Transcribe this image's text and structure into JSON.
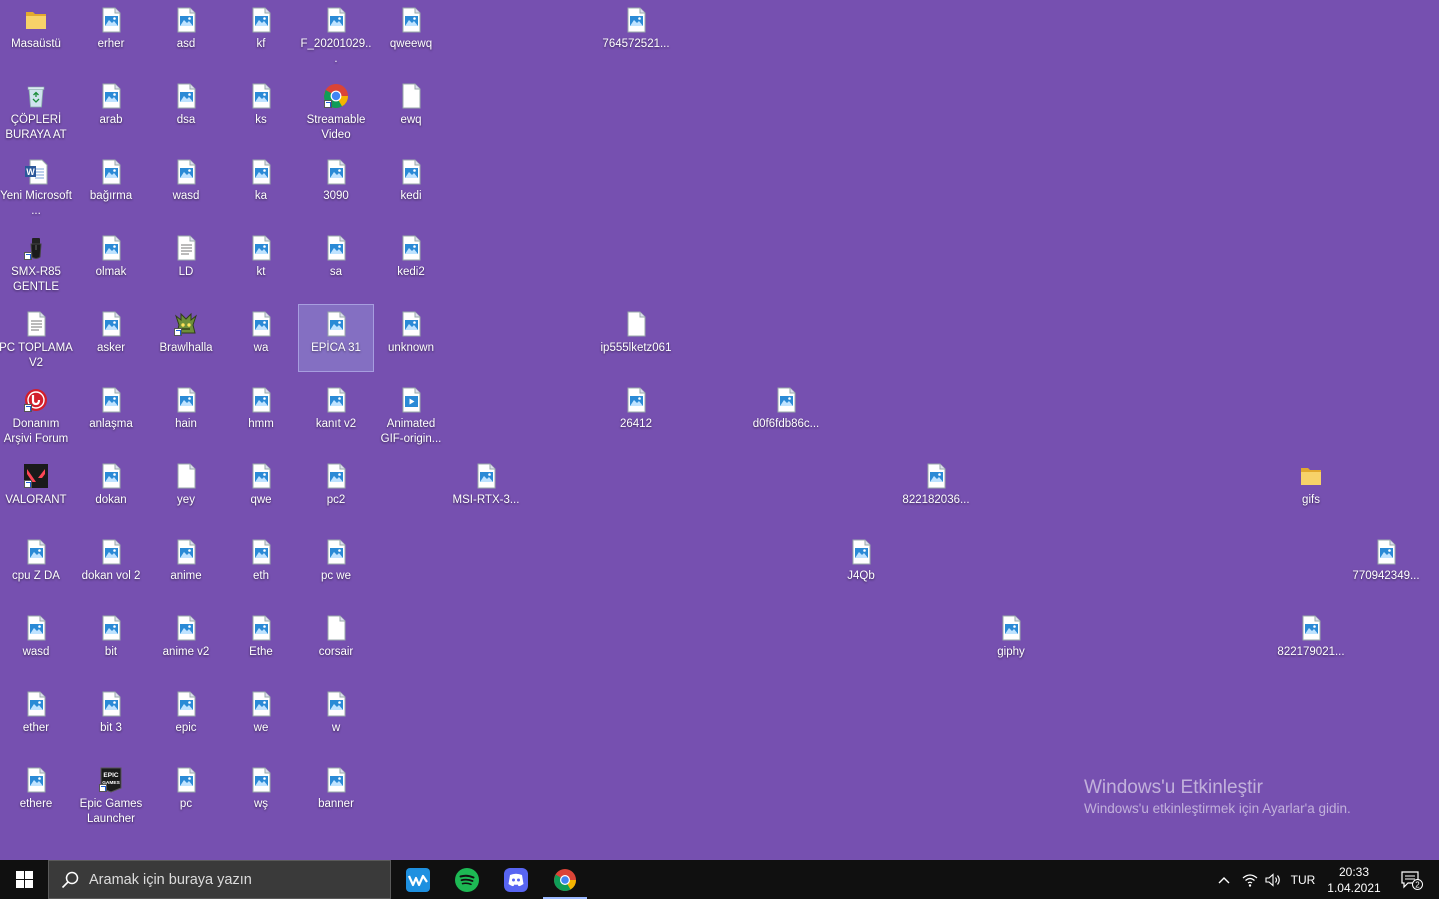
{
  "desktop": {
    "background_color": "#7650b0",
    "icons": [
      {
        "label": "Masaüstü",
        "type": "folder",
        "col": 0,
        "row": 0
      },
      {
        "label": "ÇÖPLERİ BURAYA AT",
        "type": "recycle",
        "col": 0,
        "row": 1
      },
      {
        "label": "Yeni Microsoft ...",
        "type": "word",
        "col": 0,
        "row": 2
      },
      {
        "label": "SMX-R85 GENTLE",
        "type": "mouse",
        "col": 0,
        "row": 3
      },
      {
        "label": "PC TOPLAMA V2",
        "type": "text",
        "col": 0,
        "row": 4
      },
      {
        "label": "Donanım Arşivi Forum",
        "type": "donanim",
        "col": 0,
        "row": 5
      },
      {
        "label": "VALORANT",
        "type": "valorant",
        "col": 0,
        "row": 6
      },
      {
        "label": "cpu Z DA",
        "type": "image",
        "col": 0,
        "row": 7
      },
      {
        "label": "wasd",
        "type": "image",
        "col": 0,
        "row": 8
      },
      {
        "label": "ether",
        "type": "image",
        "col": 0,
        "row": 9
      },
      {
        "label": "ethere",
        "type": "image",
        "col": 0,
        "row": 10
      },
      {
        "label": "erher",
        "type": "image",
        "col": 1,
        "row": 0
      },
      {
        "label": "arab",
        "type": "image",
        "col": 1,
        "row": 1
      },
      {
        "label": "bağırma",
        "type": "image",
        "col": 1,
        "row": 2
      },
      {
        "label": "olmak",
        "type": "image",
        "col": 1,
        "row": 3
      },
      {
        "label": "asker",
        "type": "image",
        "col": 1,
        "row": 4
      },
      {
        "label": "anlaşma",
        "type": "image",
        "col": 1,
        "row": 5
      },
      {
        "label": "dokan",
        "type": "image",
        "col": 1,
        "row": 6
      },
      {
        "label": "dokan vol 2",
        "type": "image",
        "col": 1,
        "row": 7
      },
      {
        "label": "bit",
        "type": "image",
        "col": 1,
        "row": 8
      },
      {
        "label": "bit 3",
        "type": "image",
        "col": 1,
        "row": 9
      },
      {
        "label": "Epic Games Launcher",
        "type": "epic",
        "col": 1,
        "row": 10
      },
      {
        "label": "asd",
        "type": "image",
        "col": 2,
        "row": 0
      },
      {
        "label": "dsa",
        "type": "image",
        "col": 2,
        "row": 1
      },
      {
        "label": "wasd",
        "type": "image",
        "col": 2,
        "row": 2
      },
      {
        "label": "LD",
        "type": "text",
        "col": 2,
        "row": 3
      },
      {
        "label": "Brawlhalla",
        "type": "brawl",
        "col": 2,
        "row": 4
      },
      {
        "label": "hain",
        "type": "image",
        "col": 2,
        "row": 5
      },
      {
        "label": "yey",
        "type": "blank",
        "col": 2,
        "row": 6
      },
      {
        "label": "anime",
        "type": "image",
        "col": 2,
        "row": 7
      },
      {
        "label": "anime v2",
        "type": "image",
        "col": 2,
        "row": 8
      },
      {
        "label": "epic",
        "type": "image",
        "col": 2,
        "row": 9
      },
      {
        "label": "pc",
        "type": "image",
        "col": 2,
        "row": 10
      },
      {
        "label": "kf",
        "type": "image",
        "col": 3,
        "row": 0
      },
      {
        "label": "ks",
        "type": "image",
        "col": 3,
        "row": 1
      },
      {
        "label": "ka",
        "type": "image",
        "col": 3,
        "row": 2
      },
      {
        "label": "kt",
        "type": "image",
        "col": 3,
        "row": 3
      },
      {
        "label": "wa",
        "type": "image",
        "col": 3,
        "row": 4
      },
      {
        "label": "hmm",
        "type": "image",
        "col": 3,
        "row": 5
      },
      {
        "label": "qwe",
        "type": "image",
        "col": 3,
        "row": 6
      },
      {
        "label": "eth",
        "type": "image",
        "col": 3,
        "row": 7
      },
      {
        "label": "Ethe",
        "type": "image",
        "col": 3,
        "row": 8
      },
      {
        "label": "we",
        "type": "image",
        "col": 3,
        "row": 9
      },
      {
        "label": "wş",
        "type": "image",
        "col": 3,
        "row": 10
      },
      {
        "label": "F_20201029...",
        "type": "image",
        "col": 4,
        "row": 0
      },
      {
        "label": "Streamable Video",
        "type": "chrome",
        "col": 4,
        "row": 1
      },
      {
        "label": "3090",
        "type": "image",
        "col": 4,
        "row": 2
      },
      {
        "label": "sa",
        "type": "image",
        "col": 4,
        "row": 3
      },
      {
        "label": "EPİCA 31",
        "type": "image",
        "col": 4,
        "row": 4,
        "selected": true
      },
      {
        "label": "kanıt v2",
        "type": "image",
        "col": 4,
        "row": 5
      },
      {
        "label": "pc2",
        "type": "image",
        "col": 4,
        "row": 6
      },
      {
        "label": "pc we",
        "type": "image",
        "col": 4,
        "row": 7
      },
      {
        "label": "corsair",
        "type": "blank",
        "col": 4,
        "row": 8
      },
      {
        "label": "w",
        "type": "image",
        "col": 4,
        "row": 9
      },
      {
        "label": "banner",
        "type": "image",
        "col": 4,
        "row": 10
      },
      {
        "label": "qweewq",
        "type": "image",
        "col": 5,
        "row": 0
      },
      {
        "label": "ewq",
        "type": "blank",
        "col": 5,
        "row": 1
      },
      {
        "label": "kedi",
        "type": "image",
        "col": 5,
        "row": 2
      },
      {
        "label": "kedi2",
        "type": "image",
        "col": 5,
        "row": 3
      },
      {
        "label": "unknown",
        "type": "image",
        "col": 5,
        "row": 4
      },
      {
        "label": "Animated GIF-origin...",
        "type": "video",
        "col": 5,
        "row": 5
      },
      {
        "label": "MSI-RTX-3...",
        "type": "image",
        "col": 6,
        "row": 6
      },
      {
        "label": "764572521...",
        "type": "image",
        "col": 8,
        "row": 0
      },
      {
        "label": "ip555lketz061",
        "type": "blank",
        "col": 8,
        "row": 4
      },
      {
        "label": "26412",
        "type": "image",
        "col": 8,
        "row": 5
      },
      {
        "label": "d0f6fdb86c...",
        "type": "image",
        "col": 10,
        "row": 5
      },
      {
        "label": "J4Qb",
        "type": "image",
        "col": 11,
        "row": 7
      },
      {
        "label": "822182036...",
        "type": "image",
        "col": 12,
        "row": 6
      },
      {
        "label": "giphy",
        "type": "image",
        "col": 13,
        "row": 8
      },
      {
        "label": "gifs",
        "type": "folder",
        "col": 17,
        "row": 6
      },
      {
        "label": "822179021...",
        "type": "image",
        "col": 17,
        "row": 8
      },
      {
        "label": "770942349...",
        "type": "image",
        "col": 18,
        "row": 7
      }
    ]
  },
  "watermark": {
    "title": "Windows'u Etkinleştir",
    "subtitle": "Windows'u etkinleştirmek için Ayarlar'a gidin."
  },
  "taskbar": {
    "search_placeholder": "Aramak için buraya yazın",
    "apps": [
      {
        "name": "wallpaper-engine-icon",
        "active": false
      },
      {
        "name": "spotify-icon",
        "active": false
      },
      {
        "name": "discord-icon",
        "active": false
      },
      {
        "name": "chrome-icon",
        "active": true
      }
    ],
    "language": "TUR",
    "time": "20:33",
    "date": "1.04.2021",
    "notification_count": "2"
  }
}
